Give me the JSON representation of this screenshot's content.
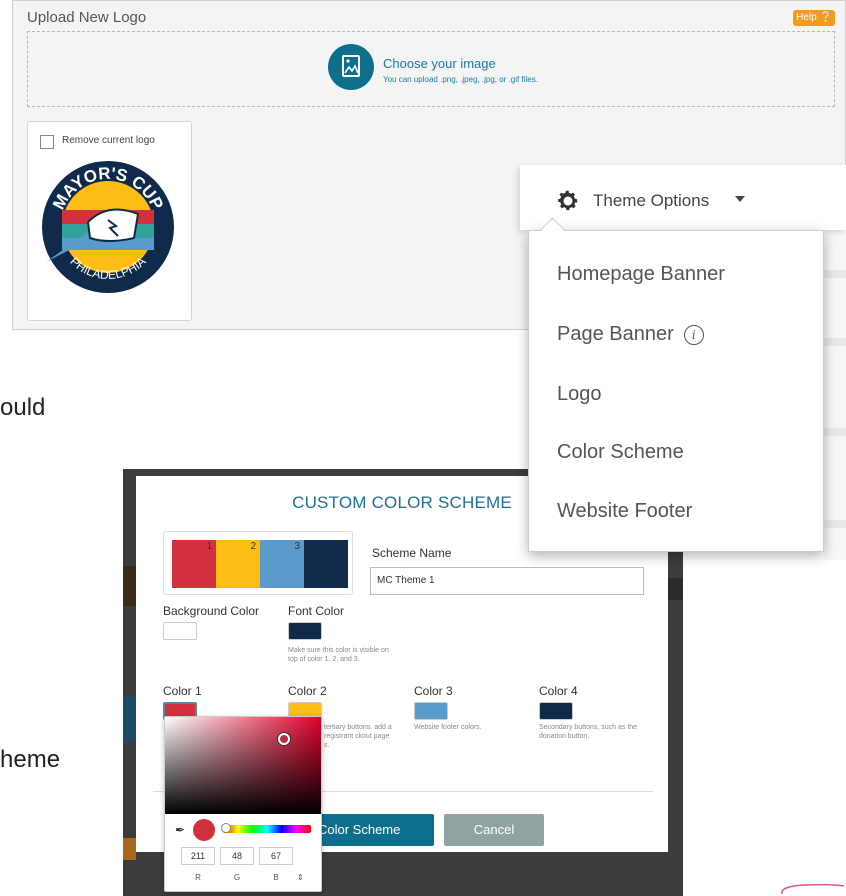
{
  "upload": {
    "title": "Upload New Logo",
    "help": "Help",
    "choose_title": "Choose your image",
    "choose_sub": "You can upload .png, .jpeg, .jpg, or .gif files.",
    "remove_label": "Remove current logo"
  },
  "logo_text": {
    "top": "MAYOR'S CUP",
    "bottom": "PHILADELPHIA"
  },
  "background_text": {
    "fragment_1": "ould",
    "fragment_2": "heme"
  },
  "modal": {
    "title": "CUSTOM COLOR SCHEME",
    "scheme_name_label": "Scheme Name",
    "scheme_name_value": "MC Theme 1",
    "preview_numbers": [
      "1",
      "2",
      "3"
    ],
    "preview_colors": [
      "#d3303f",
      "#fdbd14",
      "#5a9bcb",
      "#0f2a4a"
    ],
    "background_color_label": "Background Color",
    "background_color": "#ffffff",
    "font_color_label": "Font Color",
    "font_color": "#0f2a4a",
    "font_color_hint": "Make sure this color is visible on top of color 1, 2, and 3.",
    "colors": [
      {
        "label": "Color 1",
        "color": "#d3303f",
        "hint": ""
      },
      {
        "label": "Color 2",
        "color": "#fdbd14",
        "hint": "tertiary buttons. add a registrant ckout page s."
      },
      {
        "label": "Color 3",
        "color": "#5a9bcb",
        "hint": "Website footer colors."
      },
      {
        "label": "Color 4",
        "color": "#0f2a4a",
        "hint": "Secondary buttons, such as the donation button."
      }
    ],
    "save_label": "Color Scheme",
    "cancel_label": "Cancel"
  },
  "picker": {
    "r": "211",
    "g": "48",
    "b": "67",
    "r_label": "R",
    "g_label": "G",
    "b_label": "B",
    "arrows": "⇕",
    "current_color": "#d3303f"
  },
  "theme_menu": {
    "header": "Theme Options",
    "items": [
      "Homepage Banner",
      "Page Banner",
      "Logo",
      "Color Scheme",
      "Website Footer"
    ]
  },
  "colors": {
    "accent": "#0e6f8c",
    "help_badge": "#f39b1d",
    "cancel": "#8fa3a3"
  }
}
